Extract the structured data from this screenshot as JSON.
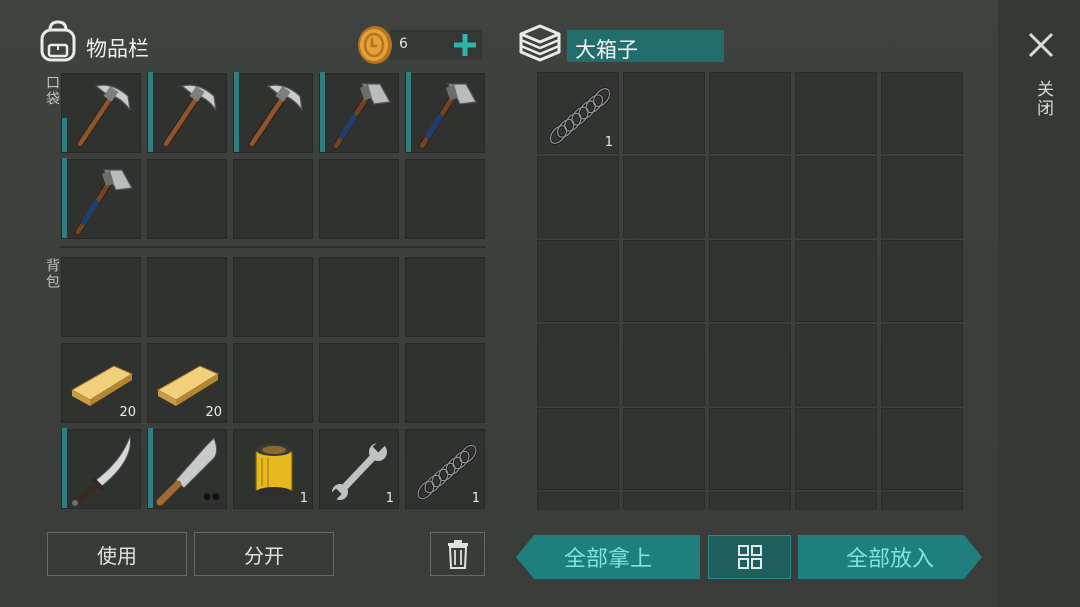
{
  "inventory": {
    "title": "物品栏",
    "coins": "6",
    "pocket_label": "口袋",
    "backpack_label": "背包"
  },
  "pocket_slots": [
    {
      "item": "pickaxe-icon",
      "count": ""
    },
    {
      "item": "pickaxe-icon",
      "count": ""
    },
    {
      "item": "pickaxe-icon",
      "count": ""
    },
    {
      "item": "hatchet-icon",
      "count": ""
    },
    {
      "item": "hatchet-icon",
      "count": ""
    },
    {
      "item": "hatchet-icon",
      "count": ""
    }
  ],
  "backpack_slots": [
    {
      "item": "",
      "count": ""
    },
    {
      "item": "",
      "count": ""
    },
    {
      "item": "",
      "count": ""
    },
    {
      "item": "",
      "count": ""
    },
    {
      "item": "",
      "count": ""
    },
    {
      "item": "wood-plank-icon",
      "count": "20"
    },
    {
      "item": "wood-plank-icon",
      "count": "20"
    },
    {
      "item": "",
      "count": ""
    },
    {
      "item": "",
      "count": ""
    },
    {
      "item": "",
      "count": ""
    },
    {
      "item": "sword-icon",
      "count": ""
    },
    {
      "item": "machete-icon",
      "count": ""
    },
    {
      "item": "oil-filter-icon",
      "count": "1"
    },
    {
      "item": "wrench-icon",
      "count": "1"
    },
    {
      "item": "spring-icon",
      "count": "1"
    }
  ],
  "container": {
    "title": "大箱子",
    "first_item": "spring-icon",
    "first_count": "1"
  },
  "close": {
    "label": "关闭"
  },
  "buttons": {
    "use": "使用",
    "split": "分开",
    "take_all": "全部拿上",
    "put_all": "全部放入"
  },
  "colors": {
    "accent": "#1f7f7c",
    "accent_text": "#7fe3df",
    "durability": "#2f7f82",
    "coin": "#d9962a"
  }
}
